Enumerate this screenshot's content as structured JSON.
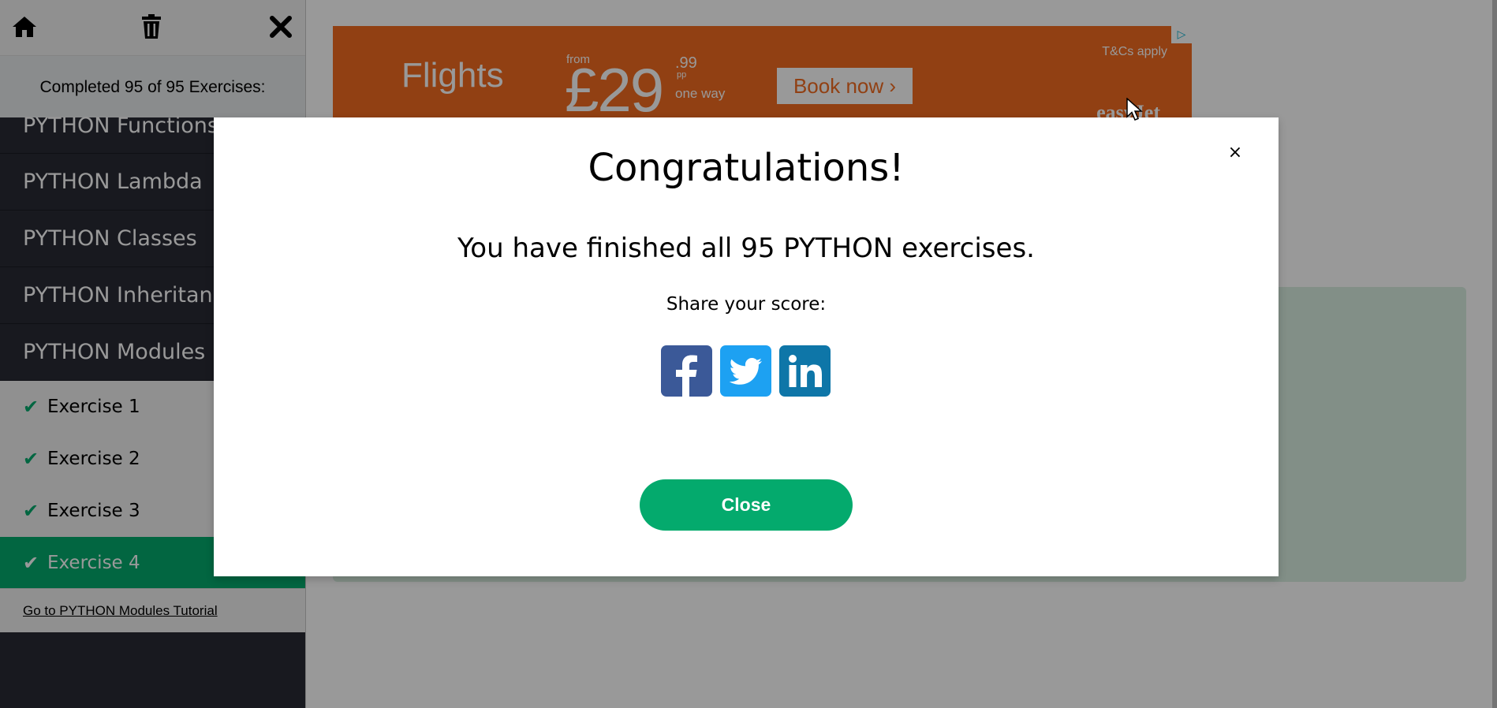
{
  "sidebar": {
    "progress_text": "Completed 95 of 95 Exercises:",
    "categories": [
      {
        "label": "PYTHON Functions"
      },
      {
        "label": "PYTHON Lambda"
      },
      {
        "label": "PYTHON Classes"
      },
      {
        "label": "PYTHON Inheritance"
      },
      {
        "label": "PYTHON Modules"
      }
    ],
    "exercises": [
      {
        "label": "Exercise 1",
        "check": "✔"
      },
      {
        "label": "Exercise 2",
        "check": "✔"
      },
      {
        "label": "Exercise 3",
        "check": "✔"
      },
      {
        "label": "Exercise 4",
        "check": "✔"
      }
    ],
    "tutorial_link": "Go to PYTHON Modules Tutorial",
    "icons": [
      "home-icon",
      "trash-icon",
      "close-icon"
    ]
  },
  "ad": {
    "headline": "Flights",
    "from": "from",
    "price": "£29",
    "pence": ".99",
    "pp": "pp",
    "one_way": "one way",
    "cta": "Book now ›",
    "terms": "T&Cs apply",
    "brand": "easyJet",
    "color": "#f26c21"
  },
  "modal": {
    "title": "Congratulations!",
    "message": "You have finished all 95 PYTHON exercises.",
    "share_label": "Share your score:",
    "close_label": "Close",
    "close_x": "×",
    "share_buttons": [
      "facebook-icon",
      "twitter-icon",
      "linkedin-icon"
    ],
    "accent": "#04aa6d"
  }
}
